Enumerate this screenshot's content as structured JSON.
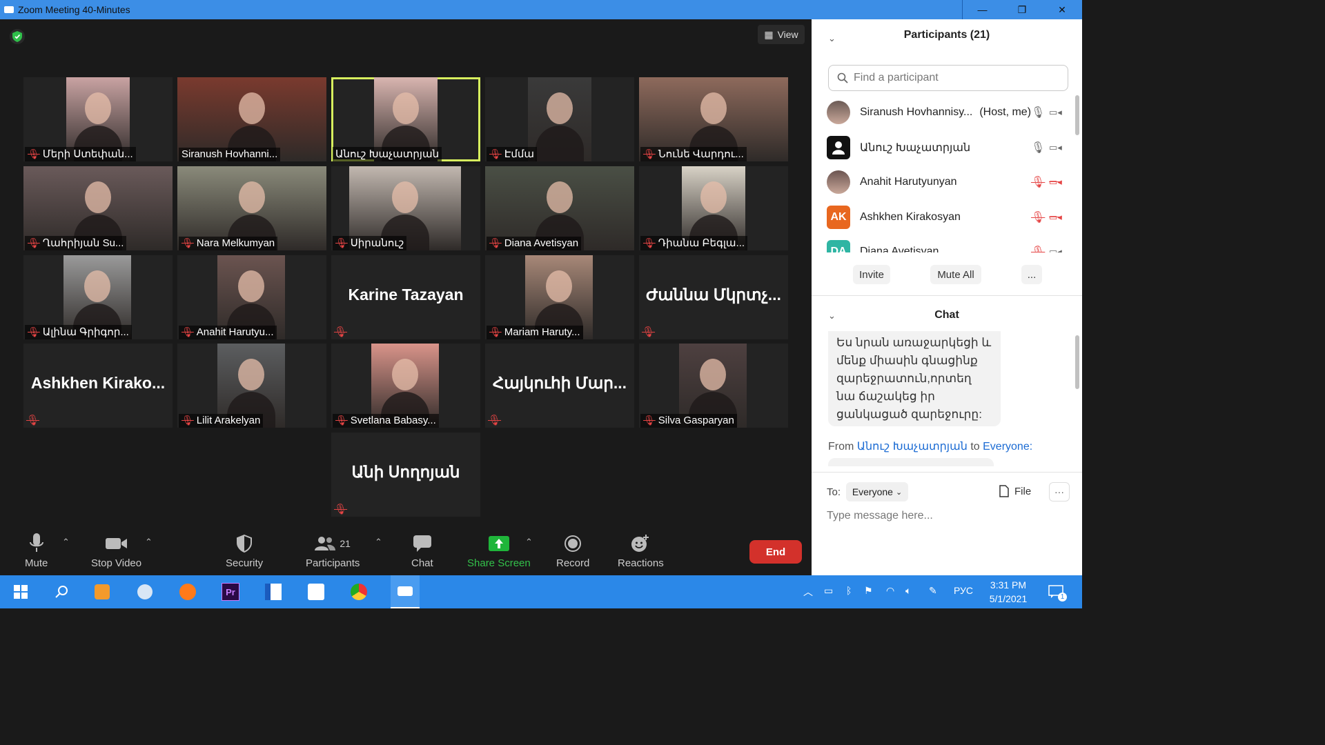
{
  "window": {
    "title": "Zoom Meeting 40-Minutes",
    "minimize": "—",
    "restore": "❐",
    "close": "✕"
  },
  "meeting": {
    "view_label": "View",
    "tiles": [
      {
        "name": "Մերի Ստեփան...",
        "muted": true,
        "type": "video",
        "photo_color": "#c9a3a3"
      },
      {
        "name": "Siranush Hovhanni...",
        "muted": false,
        "type": "video",
        "photo_color": "#7a3a2e"
      },
      {
        "name": "Անուշ Խաչատրյան",
        "muted": false,
        "type": "video",
        "photo_color": "#d9b5b0",
        "active": true
      },
      {
        "name": "Էմմա",
        "muted": true,
        "type": "video",
        "photo_color": "#3a3a3a"
      },
      {
        "name": "Նունե Վարդու...",
        "muted": true,
        "type": "video",
        "photo_color": "#8e6a5c"
      },
      {
        "name": "Ղահրիյան Su...",
        "muted": true,
        "type": "video",
        "photo_color": "#6a5a5a"
      },
      {
        "name": "Nara Melkumyan",
        "muted": true,
        "type": "video",
        "photo_color": "#8a8a7a"
      },
      {
        "name": "Սիրանուշ",
        "muted": true,
        "type": "video",
        "photo_color": "#c2b8b0"
      },
      {
        "name": "Diana Avetisyan",
        "muted": true,
        "type": "video",
        "photo_color": "#4a4f45"
      },
      {
        "name": "Դիանա Բեգլա...",
        "muted": true,
        "type": "video",
        "photo_color": "#d8d2c6"
      },
      {
        "name": "Ալինա Գրիգոր...",
        "muted": true,
        "type": "video",
        "photo_color": "#9a9a9a"
      },
      {
        "name": "Anahit Harutyu...",
        "muted": true,
        "type": "video",
        "photo_color": "#6b5450"
      },
      {
        "name": "Karine Tazayan",
        "muted": true,
        "type": "name"
      },
      {
        "name": "Mariam Haruty...",
        "muted": true,
        "type": "video",
        "photo_color": "#a88878"
      },
      {
        "name": "Ժաննա Մկրտչ...",
        "muted": true,
        "type": "name"
      },
      {
        "name": "Ashkhen Kirako...",
        "muted": true,
        "type": "name"
      },
      {
        "name": "Lilit Arakelyan",
        "muted": true,
        "type": "video",
        "photo_color": "#5c5e60"
      },
      {
        "name": "Svetlana Babasy...",
        "muted": true,
        "type": "video",
        "photo_color": "#d9948a"
      },
      {
        "name": "Հայկուհի Մար...",
        "muted": true,
        "type": "name"
      },
      {
        "name": "Silva Gasparyan",
        "muted": true,
        "type": "video",
        "photo_color": "#4e4040"
      },
      {
        "name": "Անի Սողոյան",
        "muted": true,
        "type": "name"
      }
    ]
  },
  "toolbar": {
    "mute": "Mute",
    "stop_video": "Stop Video",
    "security": "Security",
    "participants": "Participants",
    "participants_count": "21",
    "chat": "Chat",
    "share_screen": "Share Screen",
    "record": "Record",
    "reactions": "Reactions",
    "end": "End"
  },
  "participants_panel": {
    "title": "Participants (21)",
    "search_placeholder": "Find a participant",
    "list": [
      {
        "name": "Siranush Hovhannisy...",
        "tag": "(Host, me)",
        "avatar_text": "",
        "avatar_color": "#6b5a55",
        "mic_muted": false,
        "video_off": false
      },
      {
        "name": "Անուշ Խաչատրյան",
        "tag": "",
        "avatar_text": "",
        "avatar_color": "#111111",
        "mic_muted": false,
        "video_off": false
      },
      {
        "name": "Anahit Harutyunyan",
        "tag": "",
        "avatar_text": "",
        "avatar_color": "#6b5450",
        "mic_muted": true,
        "video_off": true
      },
      {
        "name": "Ashkhen Kirakosyan",
        "tag": "",
        "avatar_text": "AK",
        "avatar_color": "#e8671f",
        "mic_muted": true,
        "video_off": true
      },
      {
        "name": "Diana Avetisyan",
        "tag": "",
        "avatar_text": "DA",
        "avatar_color": "#2fb5a3",
        "mic_muted": true,
        "video_off": false
      }
    ],
    "invite": "Invite",
    "mute_all": "Mute All",
    "more": "..."
  },
  "chat_panel": {
    "title": "Chat",
    "last_message": "Ես նրան առաջարկեցի և մենք միասին գնացինք զարեջրատուն,որտեղ նա ճաշակեց իր ցանկացած զարեջուրը:",
    "from_prefix": "From",
    "from_name": "Անուշ Խաչատրյան",
    "to_word": "to",
    "to_name": "Everyone:",
    "to_label": "To:",
    "recipient": "Everyone",
    "file_label": "File",
    "more": "···",
    "input_placeholder": "Type message here..."
  },
  "taskbar": {
    "lang": "РУС",
    "time": "3:31 PM",
    "date": "5/1/2021",
    "notifications": "1"
  }
}
